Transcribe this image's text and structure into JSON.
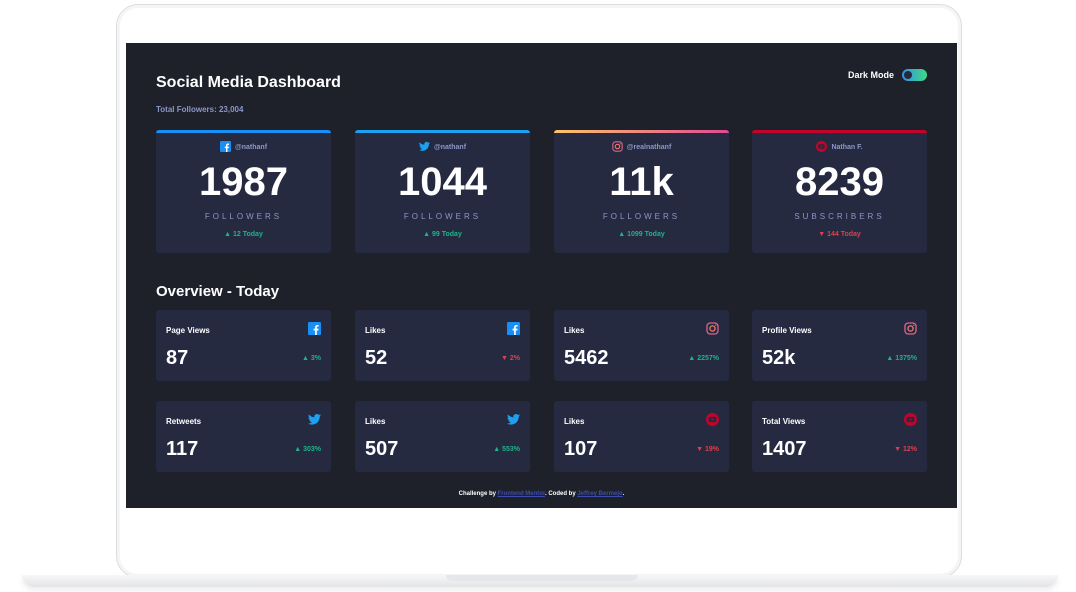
{
  "header": {
    "title": "Social Media Dashboard",
    "total_followers": "Total Followers: 23,004",
    "dark_mode_label": "Dark Mode"
  },
  "colors": {
    "facebook": "#178ff5",
    "twitter": "#1ca0f2",
    "instagram_gradient": [
      "#fdc468",
      "#df4996"
    ],
    "youtube": "#c4032a",
    "up": "#1db489",
    "down": "#dc414c",
    "card_bg": "#252a41",
    "page_bg": "#1e202a"
  },
  "cards": [
    {
      "platform": "facebook",
      "icon": "facebook-icon",
      "handle": "@nathanf",
      "count": "1987",
      "label": "FOLLOWERS",
      "today": "▲ 12 Today",
      "trend": "up"
    },
    {
      "platform": "twitter",
      "icon": "twitter-icon",
      "handle": "@nathanf",
      "count": "1044",
      "label": "FOLLOWERS",
      "today": "▲ 99 Today",
      "trend": "up"
    },
    {
      "platform": "instagram",
      "icon": "instagram-icon",
      "handle": "@realnathanf",
      "count": "11k",
      "label": "FOLLOWERS",
      "today": "▲ 1099 Today",
      "trend": "up"
    },
    {
      "platform": "youtube",
      "icon": "youtube-icon",
      "handle": "Nathan F.",
      "count": "8239",
      "label": "SUBSCRIBERS",
      "today": "▼ 144 Today",
      "trend": "down"
    }
  ],
  "overview": {
    "title": "Overview - Today",
    "items": [
      {
        "metric": "Page Views",
        "icon": "facebook-icon",
        "value": "87",
        "change": "▲ 3%",
        "trend": "up"
      },
      {
        "metric": "Likes",
        "icon": "facebook-icon",
        "value": "52",
        "change": "▼ 2%",
        "trend": "down"
      },
      {
        "metric": "Likes",
        "icon": "instagram-icon",
        "value": "5462",
        "change": "▲ 2257%",
        "trend": "up"
      },
      {
        "metric": "Profile Views",
        "icon": "instagram-icon",
        "value": "52k",
        "change": "▲ 1375%",
        "trend": "up"
      },
      {
        "metric": "Retweets",
        "icon": "twitter-icon",
        "value": "117",
        "change": "▲ 303%",
        "trend": "up"
      },
      {
        "metric": "Likes",
        "icon": "twitter-icon",
        "value": "507",
        "change": "▲ 553%",
        "trend": "up"
      },
      {
        "metric": "Likes",
        "icon": "youtube-icon",
        "value": "107",
        "change": "▼ 19%",
        "trend": "down"
      },
      {
        "metric": "Total Views",
        "icon": "youtube-icon",
        "value": "1407",
        "change": "▼ 12%",
        "trend": "down"
      }
    ]
  },
  "footer": {
    "prefix": "Challenge by ",
    "link1": "Frontend Mentor",
    "middle": ". Coded by ",
    "link2": "Jeffrey Bermejo",
    "suffix": "."
  }
}
